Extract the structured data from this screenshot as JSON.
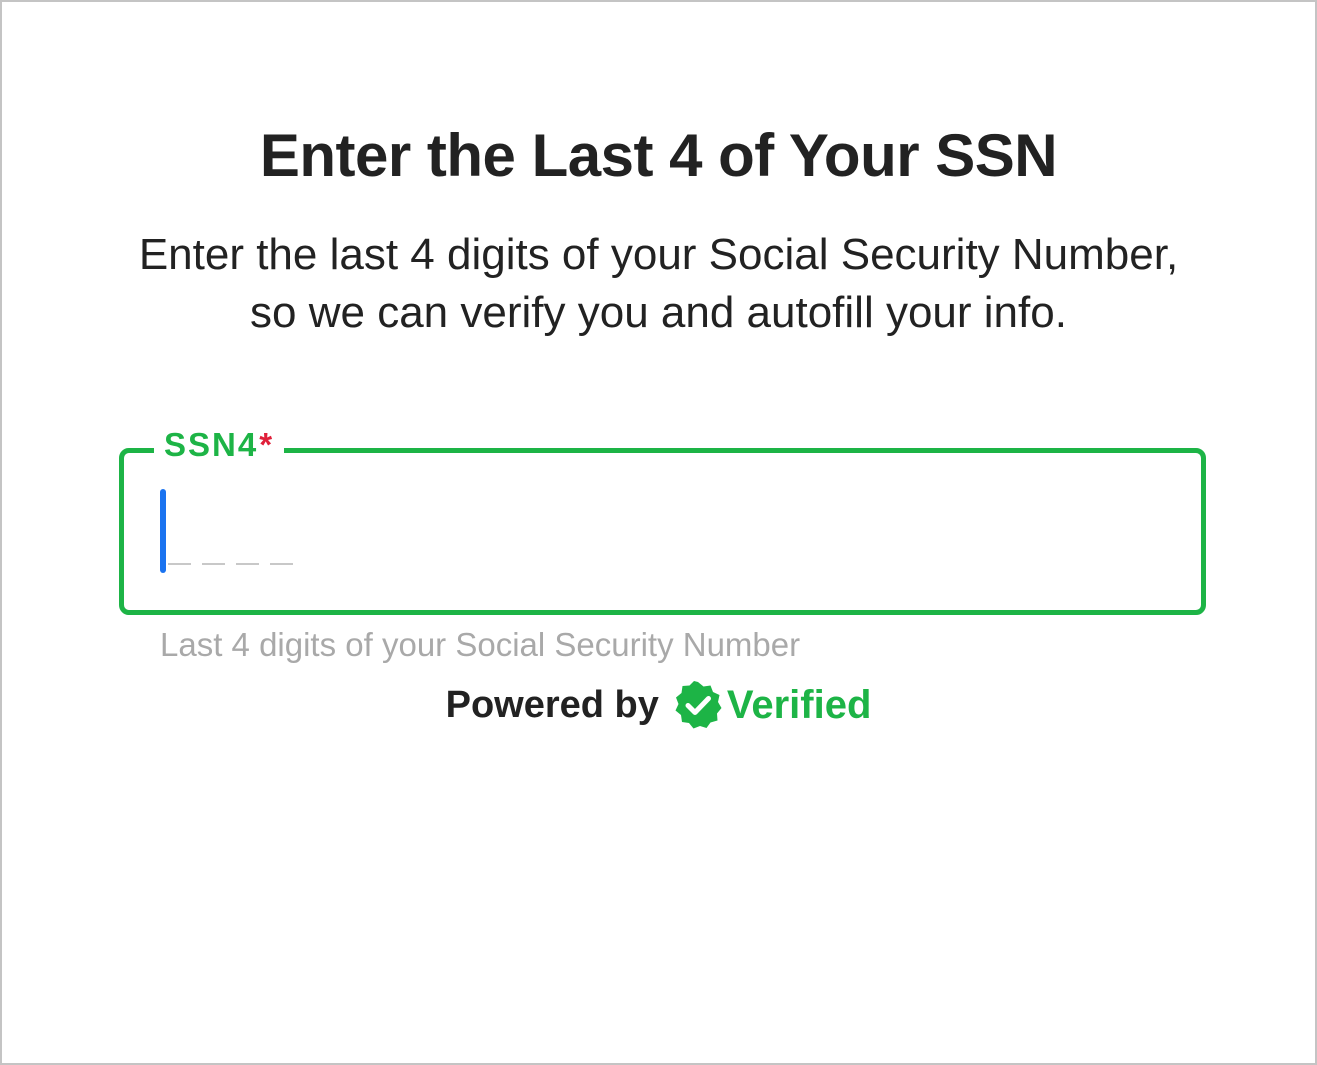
{
  "page": {
    "title": "Enter the Last 4 of Your SSN",
    "subtitle": "Enter the last 4 digits of your Social Security Number, so we can verify you and autofill your info."
  },
  "ssn_field": {
    "label": "SSN4",
    "required_mark": "*",
    "value": "",
    "helper_text": "Last 4 digits of your Social Security Number"
  },
  "footer": {
    "powered_by_label": "Powered by",
    "brand_name": "Verified",
    "brand_icon": "verified-badge-check-icon"
  },
  "colors": {
    "accent_green": "#1db446",
    "required_red": "#e0203a",
    "caret_blue": "#1a73f0",
    "helper_gray": "#a9a9a9"
  }
}
